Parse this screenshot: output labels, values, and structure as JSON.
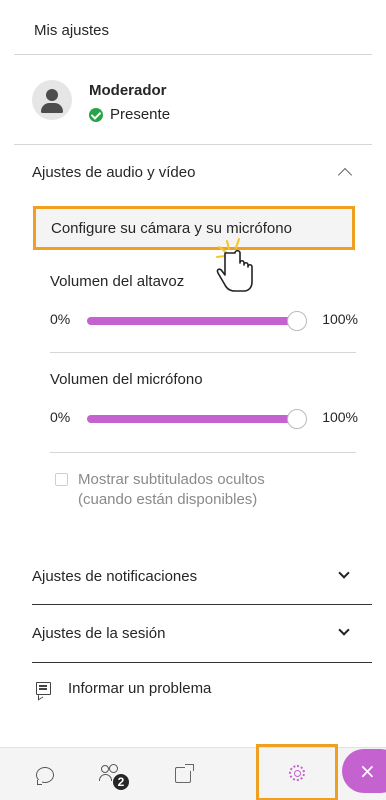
{
  "panel": {
    "title": "Mis ajustes"
  },
  "user": {
    "name": "Moderador",
    "status": "Presente"
  },
  "audio_video": {
    "section_title": "Ajustes de audio y vídeo",
    "expanded": true,
    "config_button": "Configure su cámara y su micrófono",
    "speaker": {
      "label": "Volumen del altavoz",
      "min_label": "0%",
      "max_label": "100%",
      "value_percent": 100
    },
    "microphone": {
      "label": "Volumen del micrófono",
      "min_label": "0%",
      "max_label": "100%",
      "value_percent": 100
    },
    "captions_checkbox": {
      "label_line1": "Mostrar subtitulados ocultos",
      "label_line2": "(cuando están disponibles)",
      "checked": false,
      "disabled": true
    }
  },
  "notifications": {
    "section_title": "Ajustes de notificaciones",
    "expanded": false
  },
  "session": {
    "section_title": "Ajustes de la sesión",
    "expanded": false
  },
  "report": {
    "label": "Informar un problema"
  },
  "bottom_bar": {
    "tabs": [
      {
        "name": "chat",
        "icon": "chat-bubble-icon"
      },
      {
        "name": "participants",
        "icon": "participants-icon",
        "badge": "2"
      },
      {
        "name": "share",
        "icon": "share-content-icon"
      },
      {
        "name": "settings",
        "icon": "gear-icon",
        "active": true
      }
    ],
    "close_symbol": "×"
  },
  "colors": {
    "accent": "#c462d0",
    "highlight": "#f0a020",
    "status_ok": "#27a44a"
  }
}
